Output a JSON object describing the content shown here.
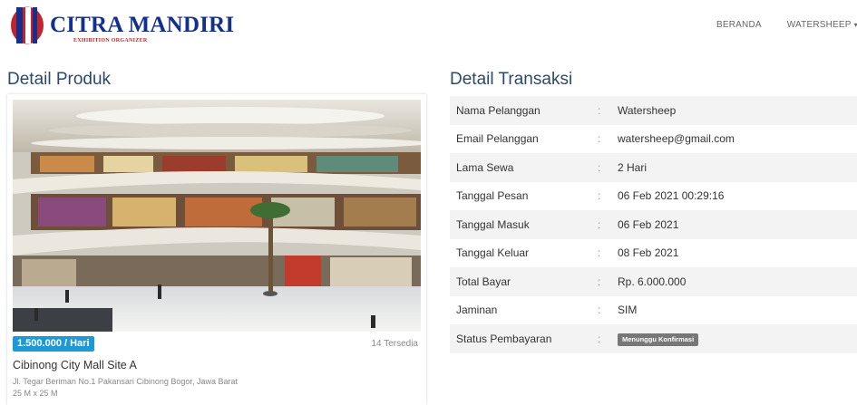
{
  "brand": {
    "title": "CITRA MANDIRI",
    "subtitle": "EXHIBITION ORGANIZER",
    "colors": {
      "navy": "#14308f",
      "red": "#c2242a"
    }
  },
  "nav": {
    "items": [
      {
        "label": "BERANDA"
      },
      {
        "label": "WATERSHEEP",
        "icon": "chevron-down-icon"
      }
    ]
  },
  "produk": {
    "heading": "Detail Produk",
    "price": "1.500.000 / Hari",
    "stock": "14 Tersedia",
    "name": "Cibinong City Mall Site A",
    "address": "Jl. Tegar Beriman No.1 Pakansari Cibinong Bogor, Jawa Barat",
    "size": "25 M x 25 M"
  },
  "transaksi": {
    "heading": "Detail Transaksi",
    "separator": ":",
    "rows": [
      {
        "label": "Nama Pelanggan",
        "value": "Watersheep"
      },
      {
        "label": "Email Pelanggan",
        "value": "watersheep@gmail.com"
      },
      {
        "label": "Lama Sewa",
        "value": "2 Hari"
      },
      {
        "label": "Tanggal Pesan",
        "value": "06 Feb 2021 00:29:16"
      },
      {
        "label": "Tanggal Masuk",
        "value": "06 Feb 2021"
      },
      {
        "label": "Tanggal Keluar",
        "value": "08 Feb 2021"
      },
      {
        "label": "Total Bayar",
        "value": "Rp. 6.000.000"
      },
      {
        "label": "Jaminan",
        "value": "SIM"
      },
      {
        "label": "Status Pembayaran",
        "value": "Menunggu Konfirmasi"
      }
    ]
  }
}
